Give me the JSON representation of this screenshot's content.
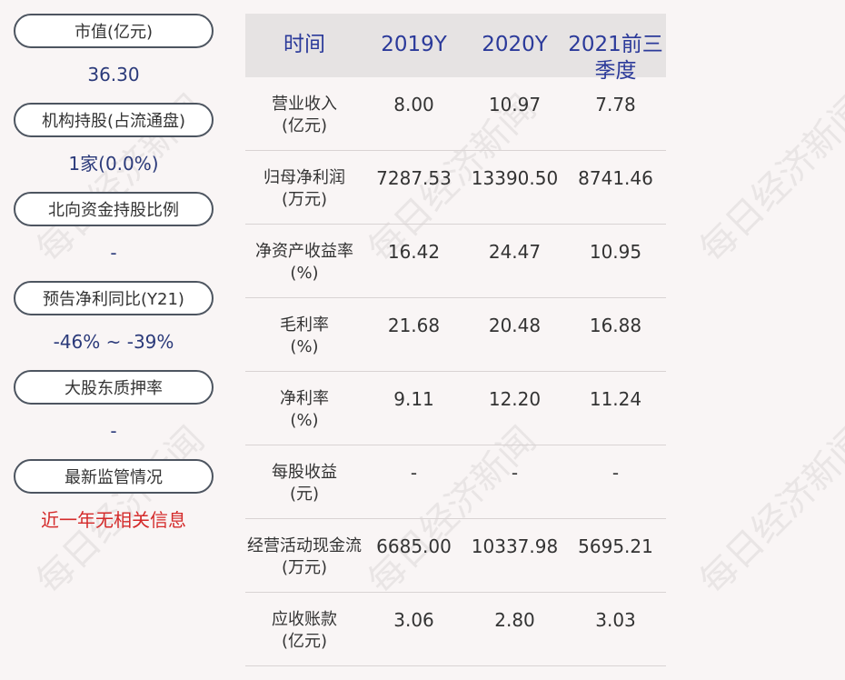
{
  "left_panel": {
    "items": [
      {
        "label": "市值(亿元)",
        "value": "36.30",
        "value_color": "#2b3a7a"
      },
      {
        "label": "机构持股(占流通盘)",
        "value": "1家(0.0%)",
        "value_color": "#2b3a7a"
      },
      {
        "label": "北向资金持股比例",
        "value": "-",
        "value_color": "#2b3a7a"
      },
      {
        "label": "预告净利同比(Y21)",
        "value": "-46% ~ -39%",
        "value_color": "#2b3a7a"
      },
      {
        "label": "大股东质押率",
        "value": "-",
        "value_color": "#2b3a7a"
      },
      {
        "label": "最新监管情况",
        "value": "近一年无相关信息",
        "value_color": "#d42a2a"
      }
    ]
  },
  "table": {
    "headers": [
      "时间",
      "2019Y",
      "2020Y",
      "2021前三季度"
    ],
    "rows": [
      {
        "label": "营业收入\n(亿元)",
        "values": [
          "8.00",
          "10.97",
          "7.78"
        ]
      },
      {
        "label": "归母净利润\n(万元)",
        "values": [
          "7287.53",
          "13390.50",
          "8741.46"
        ]
      },
      {
        "label": "净资产收益率\n(%)",
        "values": [
          "16.42",
          "24.47",
          "10.95"
        ]
      },
      {
        "label": "毛利率\n(%)",
        "values": [
          "21.68",
          "20.48",
          "16.88"
        ]
      },
      {
        "label": "净利率\n(%)",
        "values": [
          "9.11",
          "12.20",
          "11.24"
        ]
      },
      {
        "label": "每股收益\n(元)",
        "values": [
          "-",
          "-",
          "-"
        ]
      },
      {
        "label": "经营活动现金流\n(万元)",
        "values": [
          "6685.00",
          "10337.98",
          "5695.21"
        ]
      },
      {
        "label": "应收账款\n(亿元)",
        "values": [
          "3.06",
          "2.80",
          "3.03"
        ]
      }
    ]
  },
  "watermark": "每日经济新闻",
  "colors": {
    "accent_blue": "#2b3a9a",
    "value_blue": "#2b3a7a",
    "alert_red": "#d42a2a",
    "header_bg": "#e6e3e3"
  }
}
